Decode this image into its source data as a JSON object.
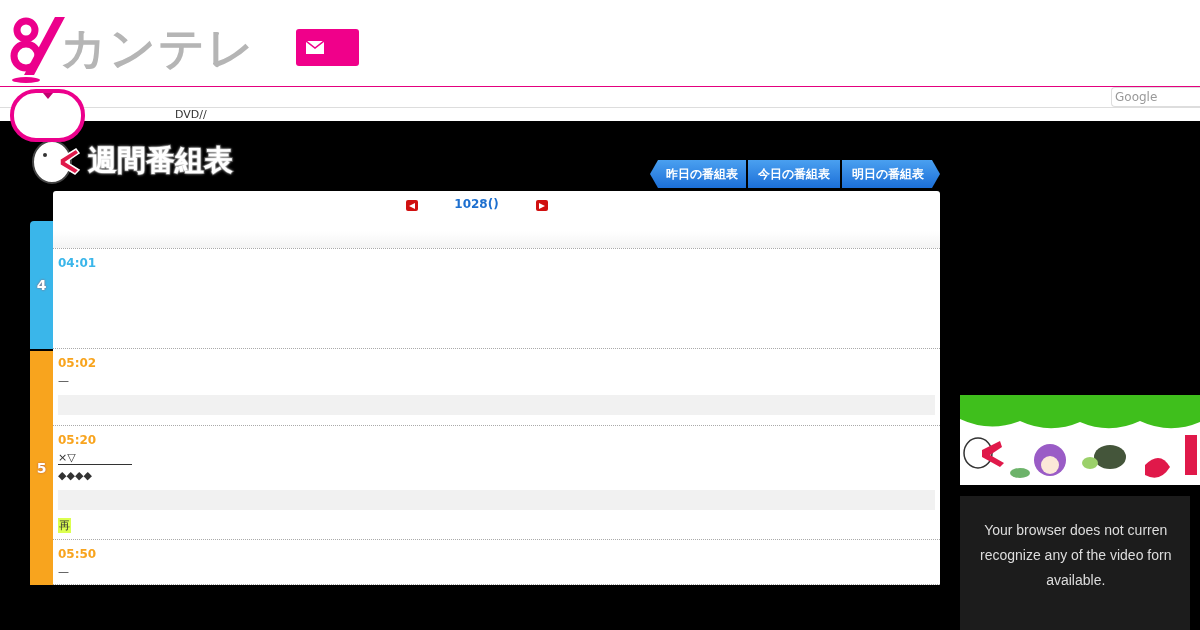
{
  "logo": {
    "text": "カンテレ"
  },
  "nav": {
    "sub_link": "DVD//",
    "search": {
      "placeholder": "Google"
    }
  },
  "schedule": {
    "title": "週間番組表",
    "day_buttons": [
      {
        "label": "昨日の番組表",
        "kind": "prev"
      },
      {
        "label": "今日の番組表",
        "kind": "today"
      },
      {
        "label": "明日の番組表",
        "kind": "next"
      }
    ],
    "date": "1028()",
    "hours": [
      {
        "label": "4",
        "color": "#3ab6ea",
        "programs": [
          {
            "time": "04:01",
            "note_bar": false
          }
        ]
      },
      {
        "label": "5",
        "color": "#f8a41e",
        "programs": [
          {
            "time": "05:02",
            "lines": [
              {
                "text": "—",
                "kind": "plain"
              }
            ],
            "note_bar": true
          },
          {
            "time": "05:20",
            "lines": [
              {
                "text": "×▽",
                "kind": "link"
              },
              {
                "text": "◆◆◆◆",
                "kind": "plain"
              }
            ],
            "note_bar": true,
            "rerun_label": "再"
          },
          {
            "time": "05:50",
            "lines": [
              {
                "text": "—",
                "kind": "plain"
              }
            ],
            "note_bar": false
          }
        ]
      }
    ]
  },
  "side": {
    "video": {
      "message_lines": [
        "Your browser does not curren",
        "recognize any of the video forn",
        "available."
      ]
    }
  }
}
